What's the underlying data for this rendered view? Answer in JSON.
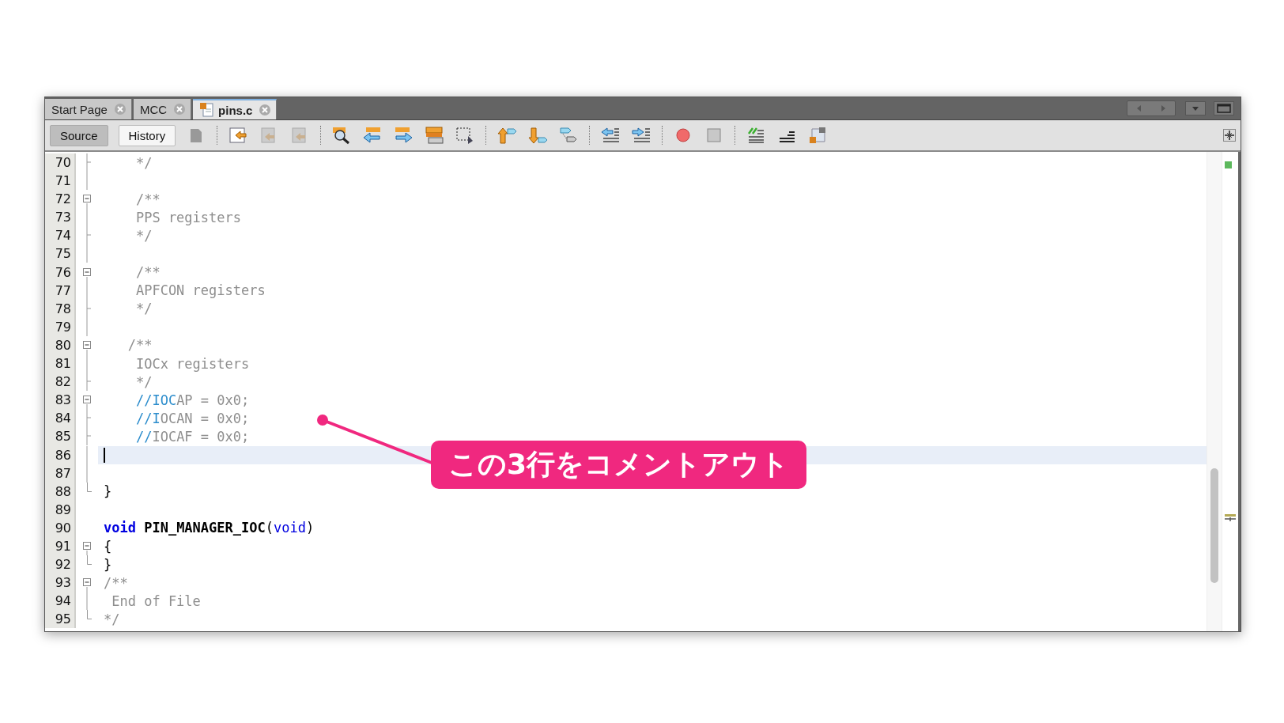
{
  "editor_tabs": [
    {
      "label": "Start Page",
      "selected": false,
      "file_icon": false
    },
    {
      "label": "MCC",
      "selected": false,
      "file_icon": false
    },
    {
      "label": "pins.c",
      "selected": true,
      "file_icon": true
    }
  ],
  "view_tabs": [
    {
      "label": "Source",
      "selected": true
    },
    {
      "label": "History",
      "selected": false
    }
  ],
  "lines": [
    {
      "number": "70",
      "kind": "tick",
      "current": false,
      "segments": [
        {
          "kind": "comment",
          "text": "    */"
        }
      ]
    },
    {
      "number": "71",
      "kind": "line",
      "current": false
    },
    {
      "number": "72",
      "kind": "start",
      "current": false,
      "segments": [
        {
          "kind": "comment",
          "text": "    /**"
        }
      ]
    },
    {
      "number": "73",
      "kind": "line",
      "current": false,
      "segments": [
        {
          "kind": "comment",
          "text": "    PPS registers"
        }
      ]
    },
    {
      "number": "74",
      "kind": "tick",
      "current": false,
      "segments": [
        {
          "kind": "comment",
          "text": "    */"
        }
      ]
    },
    {
      "number": "75",
      "kind": "line",
      "current": false
    },
    {
      "number": "76",
      "kind": "start",
      "current": false,
      "segments": [
        {
          "kind": "comment",
          "text": "    /**"
        }
      ]
    },
    {
      "number": "77",
      "kind": "line",
      "current": false,
      "segments": [
        {
          "kind": "comment",
          "text": "    APFCON registers"
        }
      ]
    },
    {
      "number": "78",
      "kind": "tick",
      "current": false,
      "segments": [
        {
          "kind": "comment",
          "text": "    */"
        }
      ]
    },
    {
      "number": "79",
      "kind": "line",
      "current": false
    },
    {
      "number": "80",
      "kind": "start",
      "current": false,
      "segments": [
        {
          "kind": "comment",
          "text": "   /**"
        }
      ]
    },
    {
      "number": "81",
      "kind": "line",
      "current": false,
      "segments": [
        {
          "kind": "comment",
          "text": "    IOCx registers"
        }
      ]
    },
    {
      "number": "82",
      "kind": "tick",
      "current": false,
      "segments": [
        {
          "kind": "comment",
          "text": "    */"
        }
      ]
    },
    {
      "number": "83",
      "kind": "start",
      "current": false,
      "segments": [
        {
          "kind": "marked",
          "text": "    //IOC"
        },
        {
          "kind": "comment",
          "text": "AP = 0x0;"
        }
      ]
    },
    {
      "number": "84",
      "kind": "tick",
      "current": false,
      "segments": [
        {
          "kind": "marked",
          "text": "    //I"
        },
        {
          "kind": "comment",
          "text": "OCAN = 0x0;"
        }
      ]
    },
    {
      "number": "85",
      "kind": "tick",
      "current": false,
      "segments": [
        {
          "kind": "marked",
          "text": "    //"
        },
        {
          "kind": "comment",
          "text": "IOCAF = 0x0;"
        }
      ]
    },
    {
      "number": "86",
      "kind": "line",
      "current": true
    },
    {
      "number": "87",
      "kind": "line",
      "current": false
    },
    {
      "number": "88",
      "kind": "end",
      "current": false,
      "segments": [
        {
          "kind": "code",
          "text": "}"
        }
      ]
    },
    {
      "number": "89",
      "kind": "plain",
      "current": false
    },
    {
      "number": "90",
      "kind": "plain",
      "current": false,
      "segments": [
        {
          "kind": "keyword",
          "text": "void"
        },
        {
          "kind": "function",
          "text": " PIN_MANAGER_IOC"
        },
        {
          "kind": "code",
          "text": "("
        },
        {
          "kind": "type",
          "text": "void"
        },
        {
          "kind": "code",
          "text": ")"
        }
      ]
    },
    {
      "number": "91",
      "kind": "start",
      "current": false,
      "segments": [
        {
          "kind": "code",
          "text": "{"
        }
      ]
    },
    {
      "number": "92",
      "kind": "end",
      "current": false,
      "segments": [
        {
          "kind": "code",
          "text": "}"
        }
      ]
    },
    {
      "number": "93",
      "kind": "start",
      "current": false,
      "segments": [
        {
          "kind": "comment",
          "text": "/**"
        }
      ]
    },
    {
      "number": "94",
      "kind": "line",
      "current": false,
      "segments": [
        {
          "kind": "comment",
          "text": " End of File"
        }
      ]
    },
    {
      "number": "95",
      "kind": "end",
      "current": false,
      "segments": [
        {
          "kind": "comment",
          "text": "*/"
        }
      ]
    }
  ],
  "annotation": {
    "label": "この3行をコメントアウト"
  }
}
